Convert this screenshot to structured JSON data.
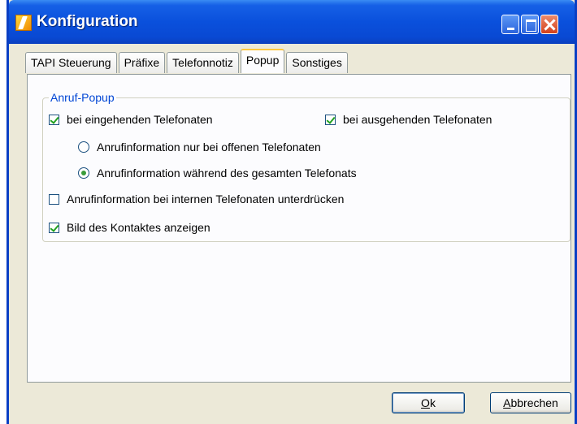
{
  "window": {
    "title": "Konfiguration"
  },
  "tabs": [
    {
      "label": "TAPI Steuerung",
      "active": false
    },
    {
      "label": "Präfixe",
      "active": false
    },
    {
      "label": "Telefonnotiz",
      "active": false
    },
    {
      "label": "Popup",
      "active": true
    },
    {
      "label": "Sonstiges",
      "active": false
    }
  ],
  "popup": {
    "group_label": "Anruf-Popup",
    "incoming": {
      "label": "bei eingehenden Telefonaten",
      "checked": true
    },
    "outgoing": {
      "label": "bei ausgehenden Telefonaten",
      "checked": true
    },
    "radio_open": {
      "label": "Anrufinformation nur bei offenen Telefonaten",
      "selected": false
    },
    "radio_whole": {
      "label": "Anrufinformation während des gesamten Telefonats",
      "selected": true
    },
    "suppress_internal": {
      "label": "Anrufinformation bei internen Telefonaten unterdrücken",
      "checked": false
    },
    "show_contact_image": {
      "label": "Bild des Kontaktes anzeigen",
      "checked": true
    }
  },
  "buttons": {
    "ok_mnemonic": "O",
    "ok_rest": "k",
    "cancel_mnemonic": "A",
    "cancel_rest": "bbrechen"
  },
  "colors": {
    "titlebar": "#0a50dc",
    "dialog_bg": "#ece9d8",
    "group_label": "#0046d5",
    "check": "#21a121"
  }
}
